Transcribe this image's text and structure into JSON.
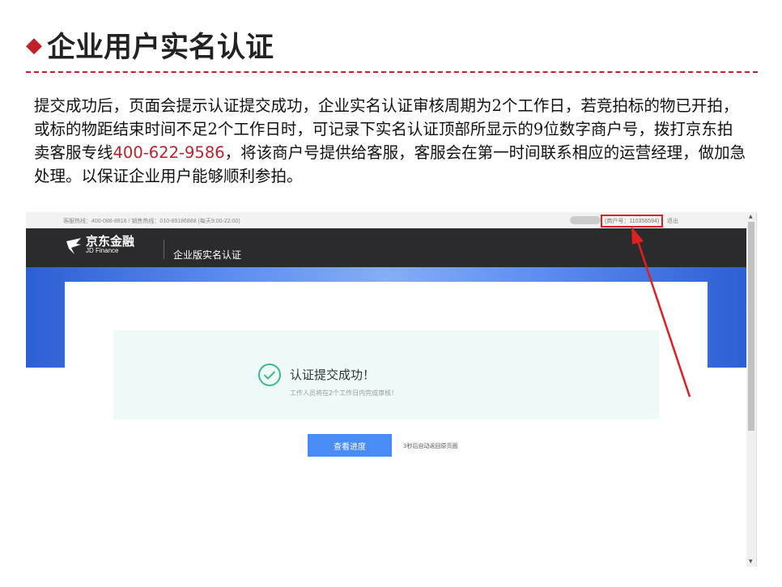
{
  "slide": {
    "title": "企业用户实名认证",
    "paragraph_part1": "提交成功后，页面会提示认证提交成功，企业实名认证审核周期为2个工作日，若竞拍标的物已开拍，或标的物距结束时间不足2个工作日时，可记录下实名认证顶部所显示的9位数字商户号，拨打京东拍卖客服专线",
    "hotline": "400-622-9586",
    "paragraph_part2": "，将该商户号提供给客服，客服会在第一时间联系相应的运营经理，做加急处理。以保证企业用户能够顺利参拍。"
  },
  "screenshot": {
    "topbar": {
      "hotlines": "客服热线：400-088-8816 / 销售热线：010-89186888 (每天9:00-22:00)",
      "merchant_id": "(商户号：110356594)",
      "logout": "退出"
    },
    "navbar": {
      "logo_cn": "京东金融",
      "logo_en": "JD Finance",
      "page_title": "企业版实名认证"
    },
    "result": {
      "title": "认证提交成功！",
      "subtitle": "工作人员将在2个工作日内完成审核！",
      "button_label": "查看进度",
      "countdown_seconds": "3",
      "auto_return_text": "秒后自动返回原页面"
    }
  },
  "colors": {
    "accent_red": "#c0202a",
    "button_blue": "#4a8cf6",
    "success_green": "#3dba8a",
    "nav_bg": "#2b2b2d"
  },
  "icons": [
    "diamond-bullet-icon",
    "jd-finance-logo-icon",
    "check-circle-icon",
    "scroll-up-icon",
    "scroll-down-icon",
    "red-arrow-annotation"
  ]
}
